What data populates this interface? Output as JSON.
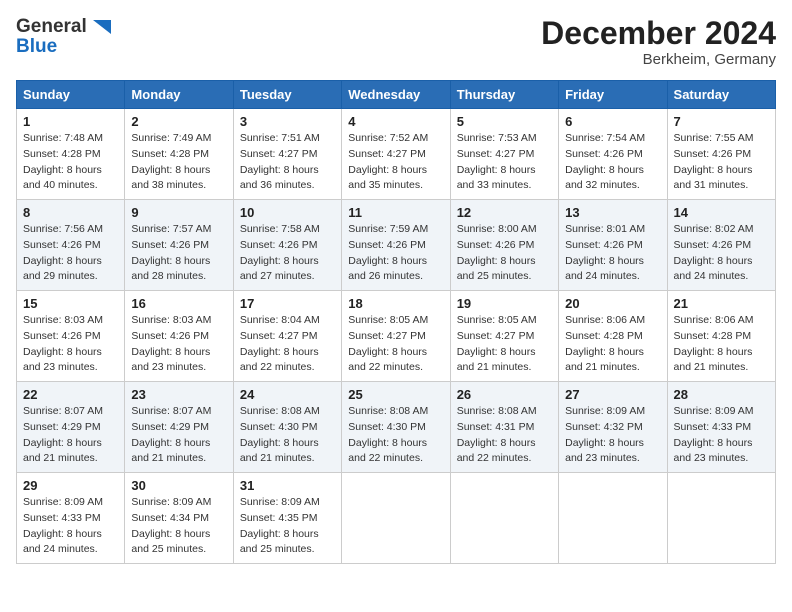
{
  "logo": {
    "general": "General",
    "blue": "Blue",
    "tagline": ""
  },
  "title": "December 2024",
  "subtitle": "Berkheim, Germany",
  "days_of_week": [
    "Sunday",
    "Monday",
    "Tuesday",
    "Wednesday",
    "Thursday",
    "Friday",
    "Saturday"
  ],
  "weeks": [
    [
      {
        "day": "1",
        "sunrise": "7:48 AM",
        "sunset": "4:28 PM",
        "daylight": "8 hours and 40 minutes."
      },
      {
        "day": "2",
        "sunrise": "7:49 AM",
        "sunset": "4:28 PM",
        "daylight": "8 hours and 38 minutes."
      },
      {
        "day": "3",
        "sunrise": "7:51 AM",
        "sunset": "4:27 PM",
        "daylight": "8 hours and 36 minutes."
      },
      {
        "day": "4",
        "sunrise": "7:52 AM",
        "sunset": "4:27 PM",
        "daylight": "8 hours and 35 minutes."
      },
      {
        "day": "5",
        "sunrise": "7:53 AM",
        "sunset": "4:27 PM",
        "daylight": "8 hours and 33 minutes."
      },
      {
        "day": "6",
        "sunrise": "7:54 AM",
        "sunset": "4:26 PM",
        "daylight": "8 hours and 32 minutes."
      },
      {
        "day": "7",
        "sunrise": "7:55 AM",
        "sunset": "4:26 PM",
        "daylight": "8 hours and 31 minutes."
      }
    ],
    [
      {
        "day": "8",
        "sunrise": "7:56 AM",
        "sunset": "4:26 PM",
        "daylight": "8 hours and 29 minutes."
      },
      {
        "day": "9",
        "sunrise": "7:57 AM",
        "sunset": "4:26 PM",
        "daylight": "8 hours and 28 minutes."
      },
      {
        "day": "10",
        "sunrise": "7:58 AM",
        "sunset": "4:26 PM",
        "daylight": "8 hours and 27 minutes."
      },
      {
        "day": "11",
        "sunrise": "7:59 AM",
        "sunset": "4:26 PM",
        "daylight": "8 hours and 26 minutes."
      },
      {
        "day": "12",
        "sunrise": "8:00 AM",
        "sunset": "4:26 PM",
        "daylight": "8 hours and 25 minutes."
      },
      {
        "day": "13",
        "sunrise": "8:01 AM",
        "sunset": "4:26 PM",
        "daylight": "8 hours and 24 minutes."
      },
      {
        "day": "14",
        "sunrise": "8:02 AM",
        "sunset": "4:26 PM",
        "daylight": "8 hours and 24 minutes."
      }
    ],
    [
      {
        "day": "15",
        "sunrise": "8:03 AM",
        "sunset": "4:26 PM",
        "daylight": "8 hours and 23 minutes."
      },
      {
        "day": "16",
        "sunrise": "8:03 AM",
        "sunset": "4:26 PM",
        "daylight": "8 hours and 23 minutes."
      },
      {
        "day": "17",
        "sunrise": "8:04 AM",
        "sunset": "4:27 PM",
        "daylight": "8 hours and 22 minutes."
      },
      {
        "day": "18",
        "sunrise": "8:05 AM",
        "sunset": "4:27 PM",
        "daylight": "8 hours and 22 minutes."
      },
      {
        "day": "19",
        "sunrise": "8:05 AM",
        "sunset": "4:27 PM",
        "daylight": "8 hours and 21 minutes."
      },
      {
        "day": "20",
        "sunrise": "8:06 AM",
        "sunset": "4:28 PM",
        "daylight": "8 hours and 21 minutes."
      },
      {
        "day": "21",
        "sunrise": "8:06 AM",
        "sunset": "4:28 PM",
        "daylight": "8 hours and 21 minutes."
      }
    ],
    [
      {
        "day": "22",
        "sunrise": "8:07 AM",
        "sunset": "4:29 PM",
        "daylight": "8 hours and 21 minutes."
      },
      {
        "day": "23",
        "sunrise": "8:07 AM",
        "sunset": "4:29 PM",
        "daylight": "8 hours and 21 minutes."
      },
      {
        "day": "24",
        "sunrise": "8:08 AM",
        "sunset": "4:30 PM",
        "daylight": "8 hours and 21 minutes."
      },
      {
        "day": "25",
        "sunrise": "8:08 AM",
        "sunset": "4:30 PM",
        "daylight": "8 hours and 22 minutes."
      },
      {
        "day": "26",
        "sunrise": "8:08 AM",
        "sunset": "4:31 PM",
        "daylight": "8 hours and 22 minutes."
      },
      {
        "day": "27",
        "sunrise": "8:09 AM",
        "sunset": "4:32 PM",
        "daylight": "8 hours and 23 minutes."
      },
      {
        "day": "28",
        "sunrise": "8:09 AM",
        "sunset": "4:33 PM",
        "daylight": "8 hours and 23 minutes."
      }
    ],
    [
      {
        "day": "29",
        "sunrise": "8:09 AM",
        "sunset": "4:33 PM",
        "daylight": "8 hours and 24 minutes."
      },
      {
        "day": "30",
        "sunrise": "8:09 AM",
        "sunset": "4:34 PM",
        "daylight": "8 hours and 25 minutes."
      },
      {
        "day": "31",
        "sunrise": "8:09 AM",
        "sunset": "4:35 PM",
        "daylight": "8 hours and 25 minutes."
      },
      null,
      null,
      null,
      null
    ]
  ],
  "labels": {
    "sunrise": "Sunrise:",
    "sunset": "Sunset:",
    "daylight": "Daylight:"
  }
}
